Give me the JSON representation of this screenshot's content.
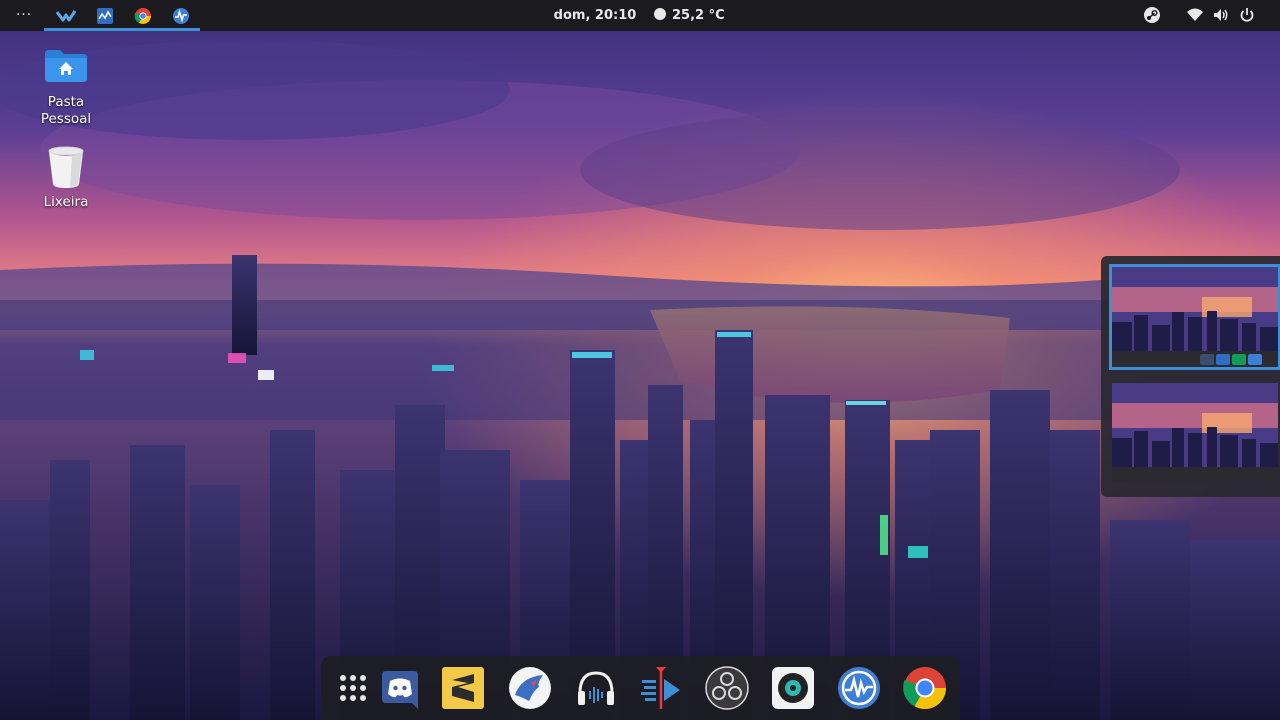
{
  "topbar": {
    "activities_label": "···",
    "apps": [
      {
        "name": "kdenlive-icon"
      },
      {
        "name": "system-monitor-icon"
      },
      {
        "name": "chrome-icon"
      },
      {
        "name": "waveform-app-icon"
      }
    ],
    "clock": "dom, 20:10",
    "weather": "25,2 °C",
    "tray": [
      "steam-icon",
      "wifi-icon",
      "volume-icon",
      "power-icon"
    ]
  },
  "desktop": {
    "icons": [
      {
        "name": "home-folder",
        "label": "Pasta Pessoal"
      },
      {
        "name": "trash",
        "label": "Lixeira"
      }
    ]
  },
  "workspaces": {
    "count": 2,
    "active_index": 0
  },
  "dock": {
    "items": [
      "app-grid-icon",
      "discord-icon",
      "sublime-text-icon",
      "ferdi-icon",
      "audio-headphones-icon",
      "kdenlive-icon",
      "obs-studio-icon",
      "record-app-icon",
      "waveform-app-icon",
      "chrome-icon"
    ]
  },
  "colors": {
    "topbar_bg": "#1b1b1f",
    "accent": "#3d8fd6",
    "dock_bg": "#1e1e22"
  }
}
